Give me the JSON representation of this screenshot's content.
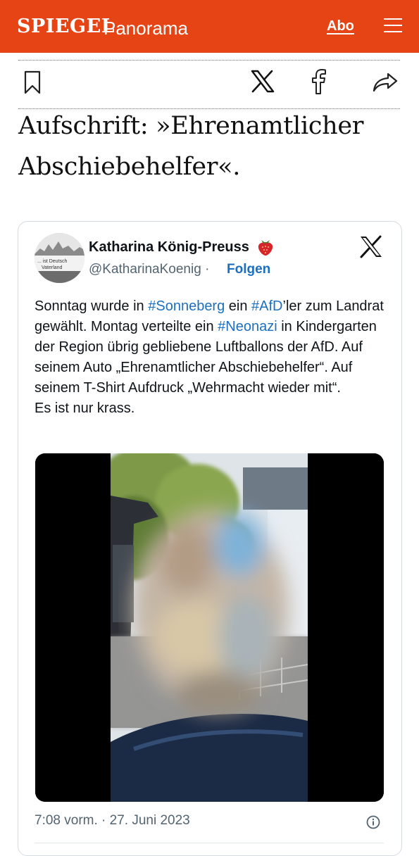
{
  "header": {
    "brand": "SPIEGEL",
    "section": "Panorama",
    "abo_label": "Abo",
    "menu_icon": "hamburger-icon",
    "background": "#e64415"
  },
  "share": {
    "bookmark_icon": "bookmark-icon",
    "x_icon": "x-logo-icon",
    "facebook_icon": "facebook-icon",
    "forward_icon": "share-arrow-icon"
  },
  "article": {
    "headline_line1": "Aufschrift: »Ehrenamtlicher",
    "headline_line2": "Abschiebehelfer«."
  },
  "tweet": {
    "author": "Katharina König-Preuss",
    "author_emoji": "strawberry",
    "handle": "@KatharinaKoenig",
    "separator": "·",
    "follow_label": "Folgen",
    "avatar_banner_text": "... ist Deutsch ... Vaterland",
    "text": {
      "p1": "Sonntag wurde in ",
      "tag1": "#Sonneberg",
      "p2": " ein ",
      "tag2": "#AfD",
      "p3": "’ler zum Landrat gewählt. Montag verteilte ein ",
      "tag3": "#Neonazi",
      "p4": " in Kindergarten der Region übrig gebliebene Luftballons der AfD. Auf seinem Auto „Ehrenamtlicher Abschiebehelfer“. Auf seinem T-Shirt Aufdruck „Wehrmacht wieder mit“.",
      "p5": "Es ist nur krass."
    },
    "hashtag_color": "#1d6fc0",
    "timestamp": "7:08 vorm. · 27. Juni 2023",
    "info_icon": "info-icon"
  }
}
